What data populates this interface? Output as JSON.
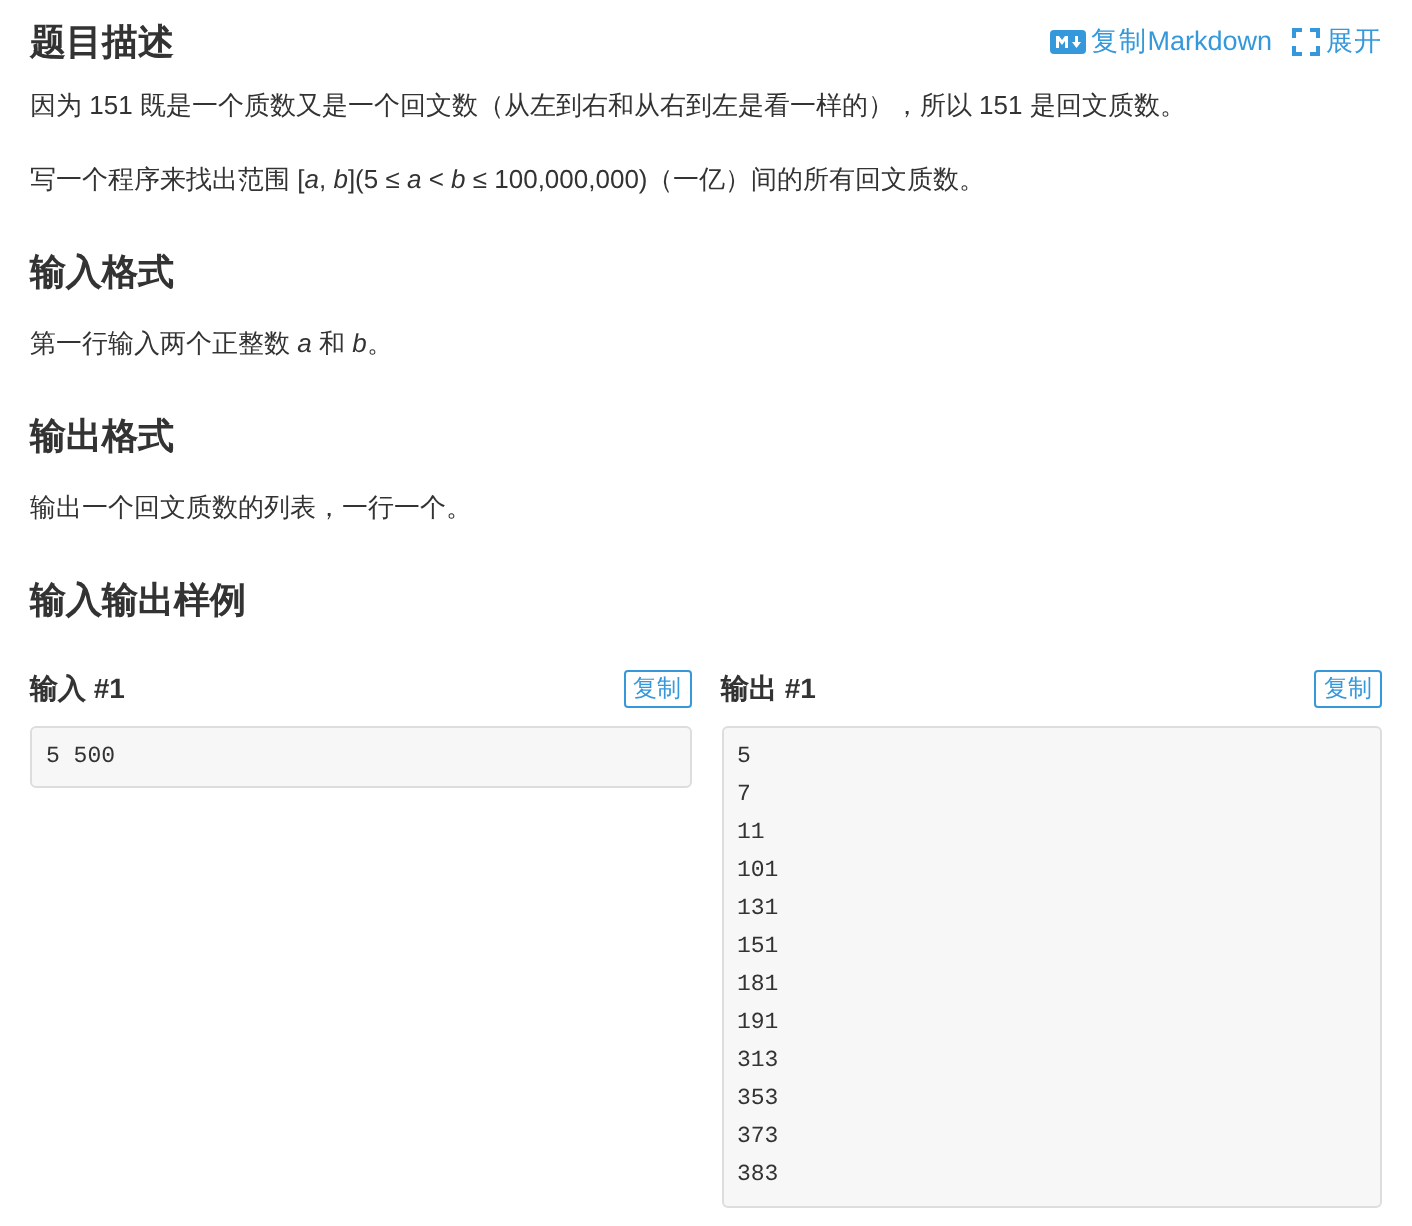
{
  "title": "题目描述",
  "actions": [
    {
      "kind": "markdown",
      "label": "复制Markdown"
    },
    {
      "kind": "expand",
      "label": "展开"
    }
  ],
  "description": [
    "因为 151 既是一个质数又是一个回文数（从左到右和从右到左是看一样的），所以 151 是回文质数。",
    "写一个程序来找出范围 [*a*, *b*](5 ≤ *a* < *b* ≤ 100,000,000)（一亿）间的所有回文质数。"
  ],
  "input_format": {
    "title": "输入格式",
    "text": "第一行输入两个正整数 *a* 和 *b*。"
  },
  "output_format": {
    "title": "输出格式",
    "text": "输出一个回文质数的列表，一行一个。"
  },
  "samples": {
    "title": "输入输出样例",
    "input": {
      "label": "输入 #1",
      "copy": "复制",
      "lines": [
        "5 500"
      ]
    },
    "output": {
      "label": "输出 #1",
      "copy": "复制",
      "lines": [
        "5",
        "7",
        "11",
        "101",
        "131",
        "151",
        "181",
        "191",
        "313",
        "353",
        "373",
        "383"
      ]
    }
  }
}
